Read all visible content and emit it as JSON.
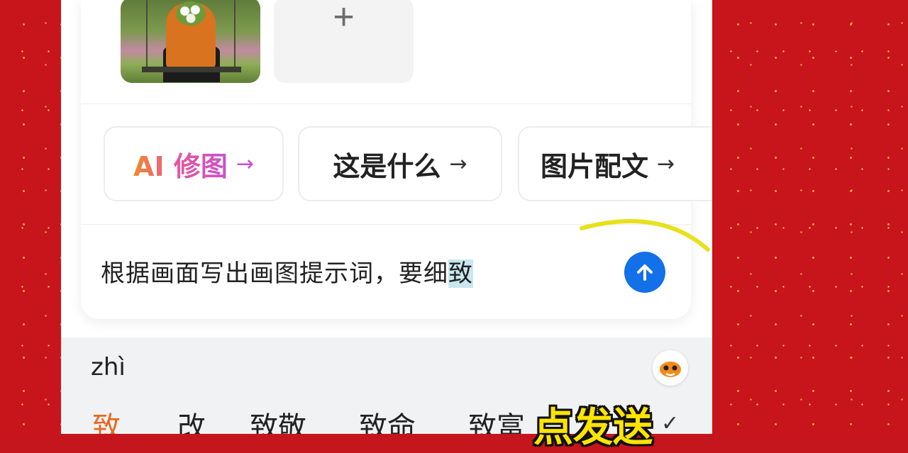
{
  "images": [
    {
      "alt": "girl holding white flowers on a swing"
    }
  ],
  "add_tile": {
    "symbol": "+"
  },
  "chips": [
    {
      "prefix": "AI ",
      "label": "修图",
      "arrow": "→"
    },
    {
      "label": "这是什么",
      "arrow": "→"
    },
    {
      "label": "图片配文",
      "arrow": "→"
    }
  ],
  "input": {
    "text": "根据画面写出画图提示词，要细",
    "composing": "致"
  },
  "keyboard": {
    "pinyin": "zhì",
    "candidates": [
      "致",
      "改",
      "致敬",
      "致命",
      "致富"
    ]
  },
  "overlay": {
    "caption": "点发送"
  },
  "colors": {
    "send_button": "#1270e8",
    "background": "#c8151b",
    "caption": "#ffe400"
  },
  "icons": {
    "send": "arrow-up-icon",
    "mascot": "mascot-icon",
    "confirm": "check-icon"
  }
}
